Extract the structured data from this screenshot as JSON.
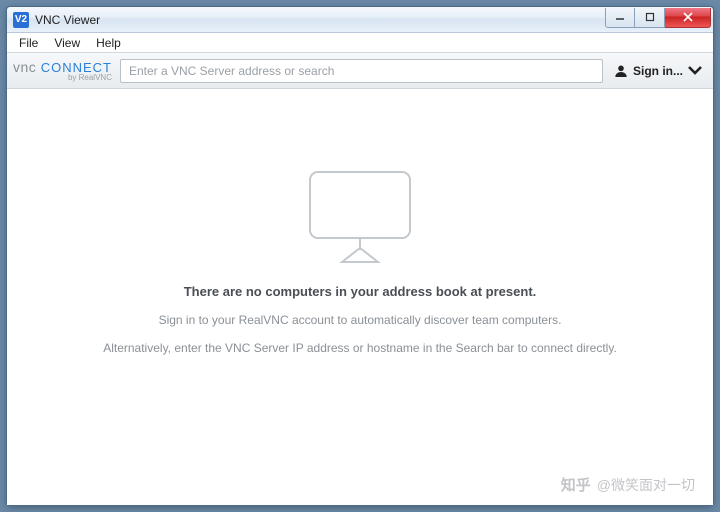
{
  "window": {
    "title": "VNC Viewer",
    "app_icon_text": "V2"
  },
  "menu": {
    "file": "File",
    "view": "View",
    "help": "Help"
  },
  "toolbar": {
    "logo_vnc": "vnc",
    "logo_connect": "CONNECT",
    "logo_sub": "by RealVNC",
    "search_placeholder": "Enter a VNC Server address or search",
    "signin_label": "Sign in..."
  },
  "empty_state": {
    "headline": "There are no computers in your address book at present.",
    "line1": "Sign in to your RealVNC account to automatically discover team computers.",
    "line2": "Alternatively, enter the VNC Server IP address or hostname in the Search bar to connect directly."
  },
  "watermark": {
    "brand": "知乎",
    "user": "@微笑面对一切"
  }
}
